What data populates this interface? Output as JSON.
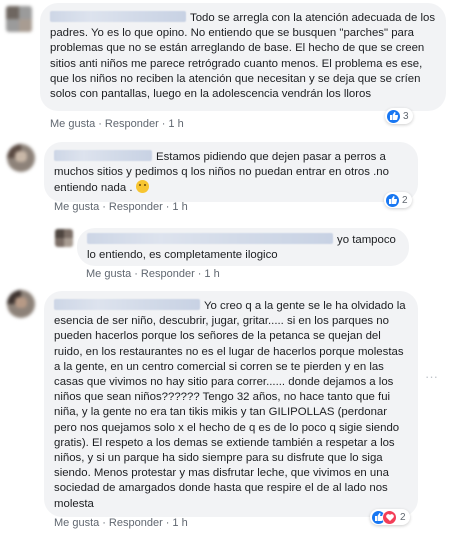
{
  "comments": [
    {
      "text": "Todo se arregla con la atención adecuada de los padres. Yo es lo que opino. No entiendo que se busquen \"parches\" para problemas que no se están arreglando de base. El hecho de que se creen sitios anti niños me parece retrógrado cuanto menos. El problema es ese, que los niños no reciben la atención que necesitan y se deja que se críen solos con pantallas, luego en la adolescencia vendrán los lloros",
      "actions": {
        "like": "Me gusta",
        "reply": "Responder",
        "time": "1 h"
      },
      "reactions": {
        "count": "3",
        "icons": [
          "like-icon"
        ]
      }
    },
    {
      "text": "Estamos pidiendo que dejen pasar a perros a muchos sitios y pedimos q los niños no puedan entrar en otros .no entiendo nada .",
      "emoji": "thinking-face-emoji",
      "actions": {
        "like": "Me gusta",
        "reply": "Responder",
        "time": "1 h"
      },
      "reactions": {
        "count": "2",
        "icons": [
          "like-icon"
        ]
      }
    },
    {
      "text": "yo tampoco lo entiendo, es completamente ilogico",
      "actions": {
        "like": "Me gusta",
        "reply": "Responder",
        "time": "1 h"
      }
    },
    {
      "text": "Yo creo q a la gente se le ha olvidado la esencia de ser niño, descubrir, jugar, gritar..... si en los parques no pueden hacerlos porque los señores de la petanca se quejan del ruido, en los restaurantes no es el lugar de hacerlos porque molestas a la gente, en un centro comercial si corren se te pierden y en las casas que vivimos no hay sitio para correr...... donde dejamos a los niños que sean niños?????? Tengo 32 años, no hace tanto que fui niña, y la gente no era tan tikis mikis y tan GILIPOLLAS (perdonar pero nos quejamos solo x el hecho de q es de lo poco q sigie siendo gratis). El respeto a los demas se extiende también a respetar a los niños, y si un parque ha sido siempre para su disfrute que lo siga siendo. Menos protestar y mas disfrutar leche, que vivimos en una sociedad de amargados donde hasta que respire el de al lado nos molesta",
      "actions": {
        "like": "Me gusta",
        "reply": "Responder",
        "time": "1 h"
      },
      "reactions": {
        "count": "2",
        "icons": [
          "like-icon",
          "love-icon"
        ]
      },
      "menu_icon": "more-options-icon"
    }
  ]
}
